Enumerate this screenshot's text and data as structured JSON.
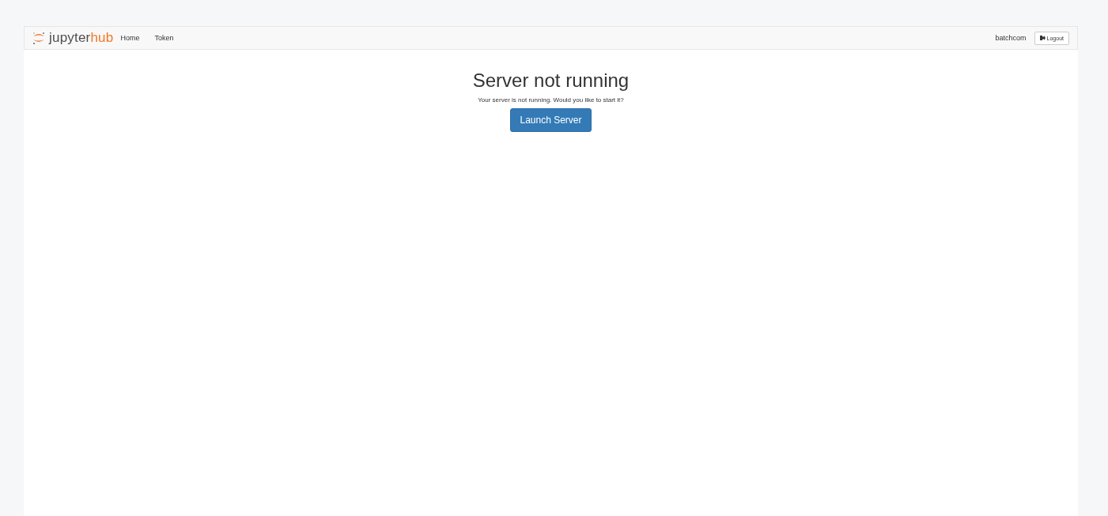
{
  "navbar": {
    "logo": {
      "main": "jupyter",
      "accent": "hub"
    },
    "links": [
      {
        "label": "Home"
      },
      {
        "label": "Token"
      }
    ],
    "user": "batchcom",
    "logout_button": "Logout"
  },
  "main": {
    "title": "Server not running",
    "message": "Your server is not running. Would you like to start it?",
    "button": "Launch Server"
  }
}
